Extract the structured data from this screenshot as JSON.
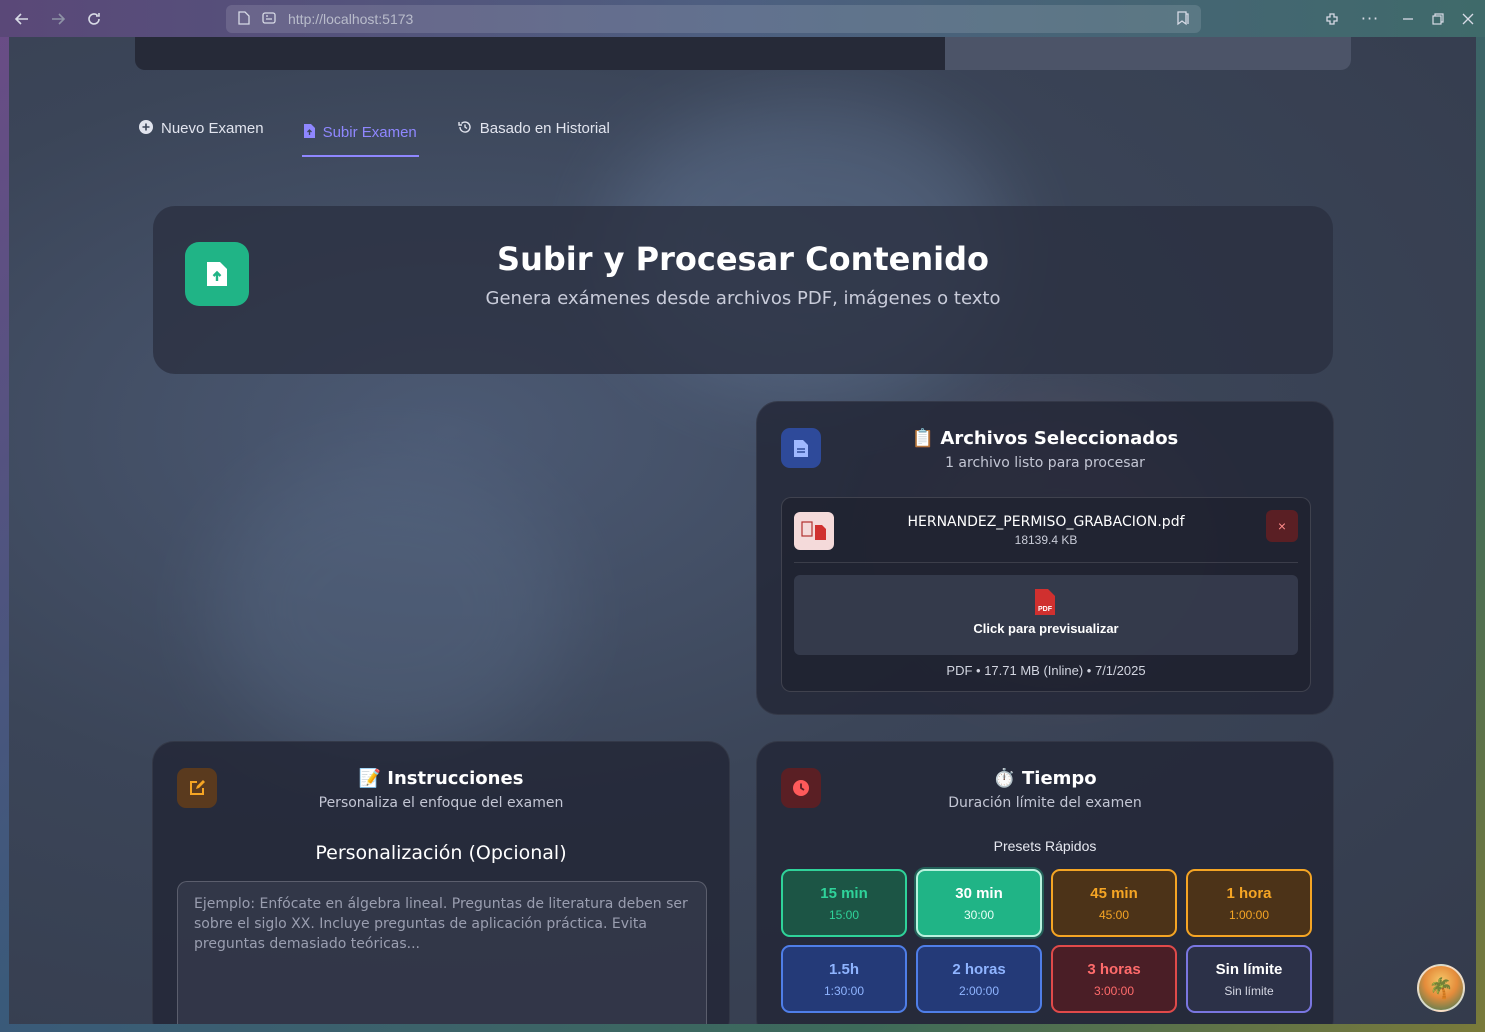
{
  "browser": {
    "url": "http://localhost:5173"
  },
  "tabs": [
    {
      "label": "Nuevo Examen",
      "active": false
    },
    {
      "label": "Subir Examen",
      "active": true
    },
    {
      "label": "Basado en Historial",
      "active": false
    }
  ],
  "header": {
    "title": "Subir y Procesar Contenido",
    "subtitle": "Genera exámenes desde archivos PDF, imágenes o texto"
  },
  "files": {
    "title": "📋 Archivos Seleccionados",
    "subtitle": "1 archivo listo para procesar",
    "items": [
      {
        "name": "HERNANDEZ_PERMISO_GRABACION.pdf",
        "size": "18139.4 KB",
        "remove_label": "×",
        "preview_label": "Click para previsualizar",
        "meta": "PDF • 17.71 MB (Inline) • 7/1/2025"
      }
    ]
  },
  "instructions": {
    "title": "📝 Instrucciones",
    "subtitle": "Personaliza el enfoque del examen",
    "heading": "Personalización (Opcional)",
    "placeholder": "Ejemplo: Enfócate en álgebra lineal. Preguntas de literatura deben ser sobre el siglo XX. Incluye preguntas de aplicación práctica. Evita preguntas demasiado teóricas...",
    "value": ""
  },
  "time": {
    "title": "⏱️ Tiempo",
    "subtitle": "Duración límite del examen",
    "presets_title": "Presets Rápidos",
    "presets": [
      {
        "label": "15 min",
        "value": "15:00",
        "color": "#2fd39a",
        "selected": false
      },
      {
        "label": "30 min",
        "value": "30:00",
        "color": "#ffffff",
        "selected": true
      },
      {
        "label": "45 min",
        "value": "45:00",
        "color": "#f5a524",
        "selected": false
      },
      {
        "label": "1 hora",
        "value": "1:00:00",
        "color": "#f5a524",
        "selected": false
      },
      {
        "label": "1.5h",
        "value": "1:30:00",
        "color": "#6aa8ff",
        "selected": false
      },
      {
        "label": "2 horas",
        "value": "2:00:00",
        "color": "#6aa8ff",
        "selected": false
      },
      {
        "label": "3 horas",
        "value": "3:00:00",
        "color": "#ff6b6b",
        "selected": false
      },
      {
        "label": "Sin límite",
        "value": "Sin límite",
        "color": "#ffffff",
        "selected": false
      }
    ]
  },
  "colors": {
    "accent": "#8f87ff",
    "success": "#20b486",
    "danger": "#d0302f"
  }
}
